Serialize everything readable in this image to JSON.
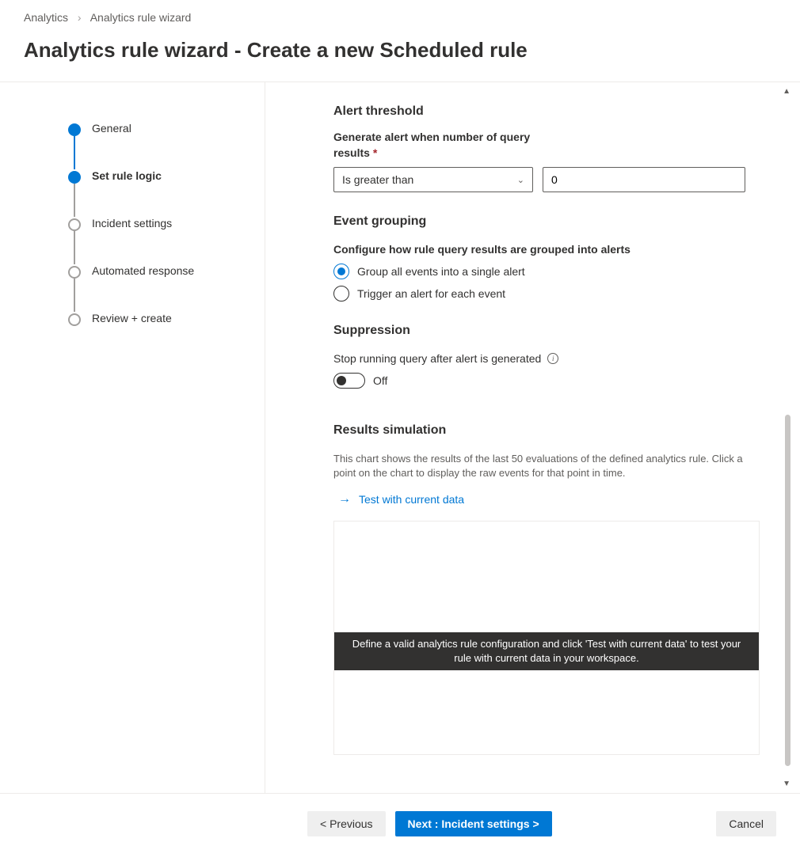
{
  "breadcrumb": {
    "root": "Analytics",
    "current": "Analytics rule wizard"
  },
  "pageTitle": "Analytics rule wizard - Create a new Scheduled rule",
  "steps": [
    {
      "label": "General",
      "state": "completed"
    },
    {
      "label": "Set rule logic",
      "state": "active"
    },
    {
      "label": "Incident settings",
      "state": "pending"
    },
    {
      "label": "Automated response",
      "state": "pending"
    },
    {
      "label": "Review + create",
      "state": "pending"
    }
  ],
  "alertThreshold": {
    "title": "Alert threshold",
    "label": "Generate alert when number of query results",
    "required": "*",
    "operator": "Is greater than",
    "value": "0"
  },
  "eventGrouping": {
    "title": "Event grouping",
    "subtitle": "Configure how rule query results are grouped into alerts",
    "options": [
      {
        "label": "Group all events into a single alert",
        "selected": true
      },
      {
        "label": "Trigger an alert for each event",
        "selected": false
      }
    ]
  },
  "suppression": {
    "title": "Suppression",
    "label": "Stop running query after alert is generated",
    "state": "Off"
  },
  "results": {
    "title": "Results simulation",
    "desc": "This chart shows the results of the last 50 evaluations of the defined analytics rule. Click a point on the chart to display the raw events for that point in time.",
    "testLink": "Test with current data",
    "banner": "Define a valid analytics rule configuration and click 'Test with current data' to test your rule with current data in your workspace."
  },
  "footer": {
    "previous": "< Previous",
    "next": "Next : Incident settings >",
    "cancel": "Cancel"
  }
}
